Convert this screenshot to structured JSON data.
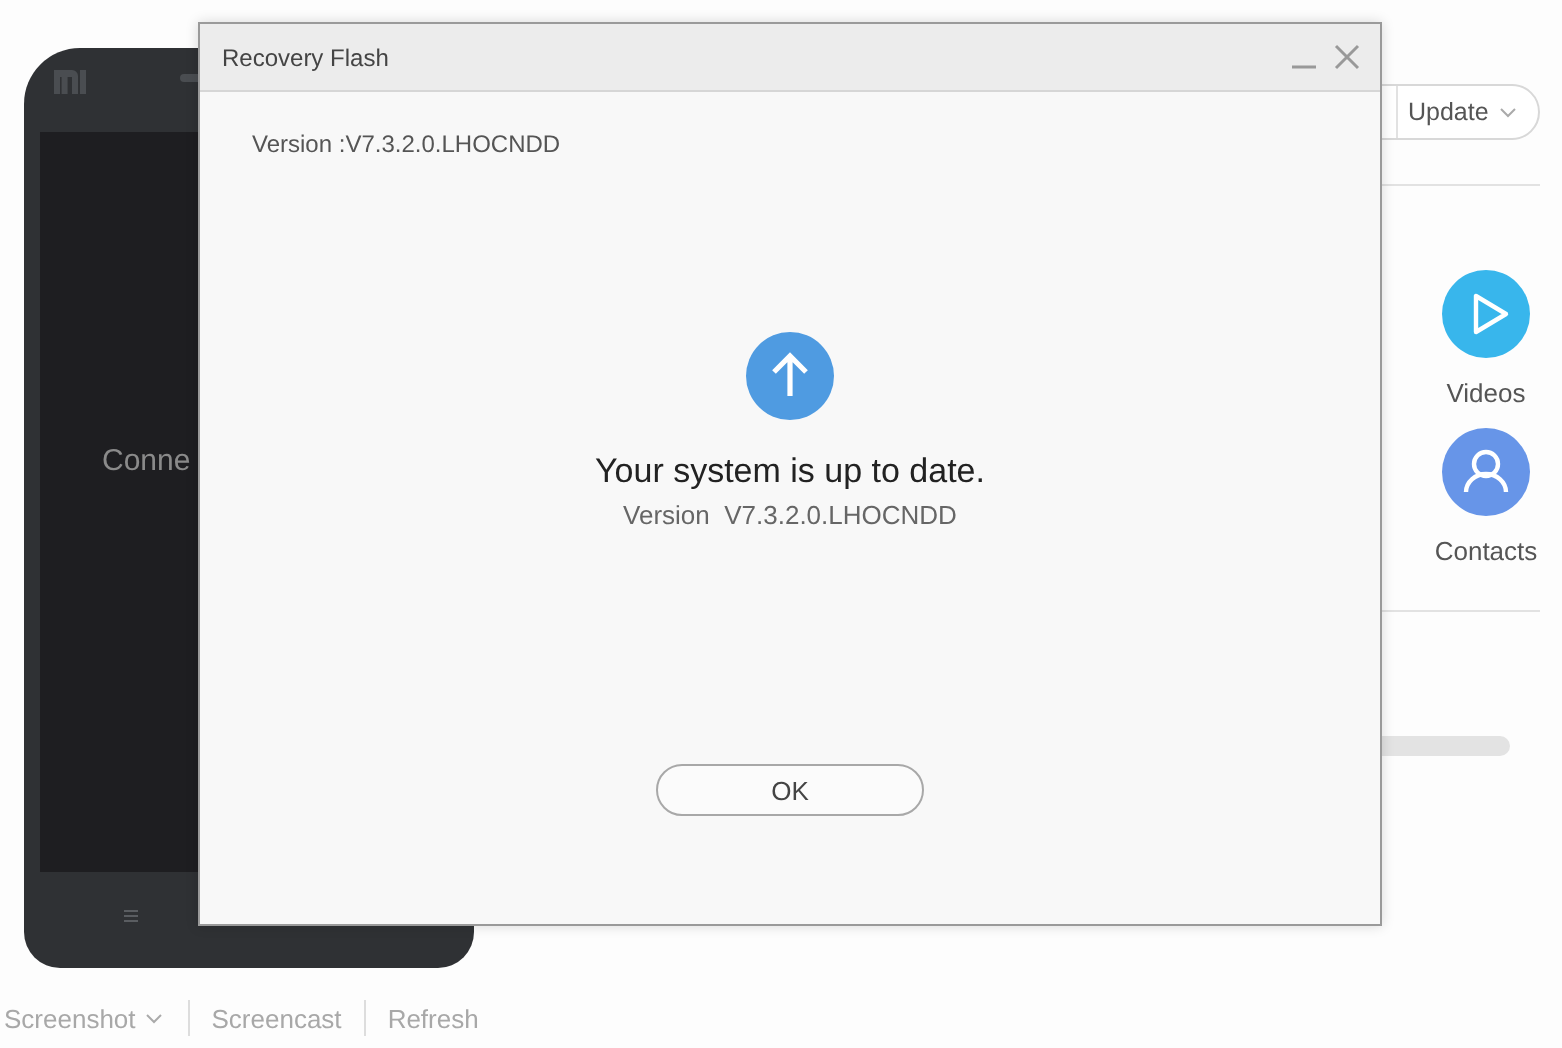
{
  "phone": {
    "screen_text": "Conne"
  },
  "toolbar": [
    {
      "label": "Screenshot",
      "dropdown": true
    },
    {
      "label": "Screencast",
      "dropdown": false
    },
    {
      "label": "Refresh",
      "dropdown": false
    }
  ],
  "update_button": {
    "label": "Update"
  },
  "shortcuts": [
    {
      "kind": "videos",
      "label": "Videos",
      "color": "#38b6ec"
    },
    {
      "kind": "contacts",
      "label": "Contacts",
      "color": "#6795e8"
    }
  ],
  "dialog": {
    "title": "Recovery Flash",
    "version_line": "Version :V7.3.2.0.LHOCNDD",
    "status": "Your system is up to date.",
    "version_detail": "Version  V7.3.2.0.LHOCNDD",
    "button": "OK"
  }
}
